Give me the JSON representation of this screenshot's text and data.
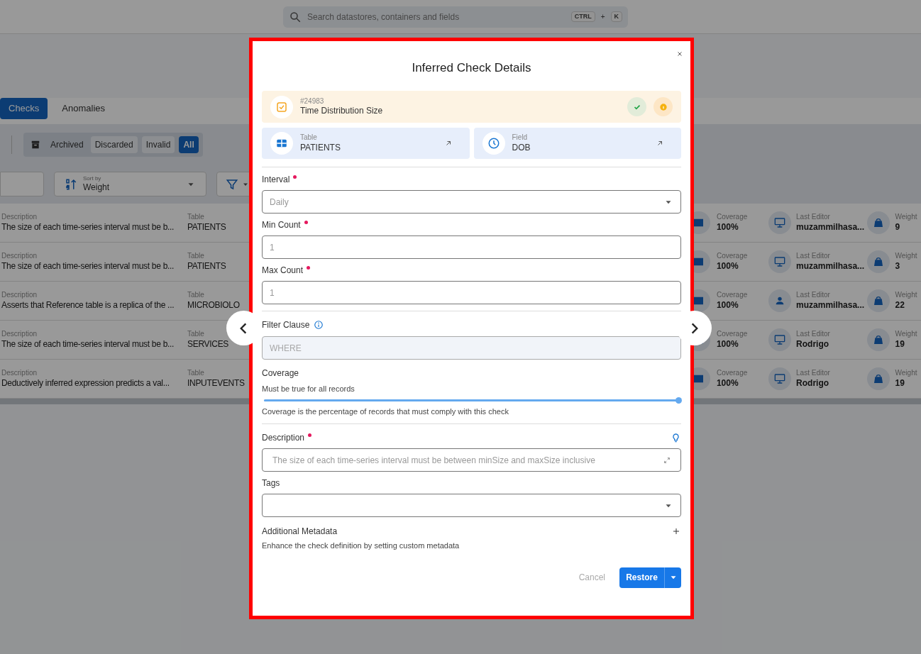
{
  "search": {
    "placeholder": "Search datastores, containers and fields",
    "keys": [
      "CTRL",
      "+",
      "K"
    ]
  },
  "tabs": [
    {
      "label": "Checks",
      "selected": true
    },
    {
      "label": "Anomalies",
      "selected": false
    }
  ],
  "status_filters": [
    {
      "label": "Archived",
      "kind": "header",
      "selected": false
    },
    {
      "label": "Discarded",
      "kind": "toggle",
      "selected": false
    },
    {
      "label": "Invalid",
      "kind": "toggle",
      "selected": false
    },
    {
      "label": "All",
      "kind": "toggle",
      "selected": true
    }
  ],
  "sort": {
    "label": "Sort by",
    "value": "Weight"
  },
  "checks": [
    {
      "description": {
        "label": "Description",
        "value": "The size of each time-series interval must be b..."
      },
      "table": {
        "label": "Table",
        "value": "PATIENTS"
      },
      "coverage": {
        "label": "Coverage",
        "value": "100%"
      },
      "last_editor": {
        "label": "Last Editor",
        "value": "muzammilhasa...",
        "kind": "monitor"
      },
      "weight": {
        "label": "Weight",
        "value": "9"
      }
    },
    {
      "description": {
        "label": "Description",
        "value": "The size of each time-series interval must be b..."
      },
      "table": {
        "label": "Table",
        "value": "PATIENTS"
      },
      "coverage": {
        "label": "Coverage",
        "value": "100%"
      },
      "last_editor": {
        "label": "Last Editor",
        "value": "muzammilhasa...",
        "kind": "monitor"
      },
      "weight": {
        "label": "Weight",
        "value": "3"
      }
    },
    {
      "description": {
        "label": "Description",
        "value": "Asserts that Reference table is a replica of the ..."
      },
      "table": {
        "label": "Table",
        "value": "MICROBIOLO"
      },
      "coverage": {
        "label": "Coverage",
        "value": "100%"
      },
      "last_editor": {
        "label": "Last Editor",
        "value": "muzammilhasa...",
        "kind": "person"
      },
      "weight": {
        "label": "Weight",
        "value": "22"
      }
    },
    {
      "description": {
        "label": "Description",
        "value": "The size of each time-series interval must be b..."
      },
      "table": {
        "label": "Table",
        "value": "SERVICES"
      },
      "coverage": {
        "label": "Coverage",
        "value": "100%"
      },
      "last_editor": {
        "label": "Last Editor",
        "value": "Rodrigo",
        "kind": "monitor"
      },
      "weight": {
        "label": "Weight",
        "value": "19"
      }
    },
    {
      "description": {
        "label": "Description",
        "value": "Deductively inferred expression predicts a val..."
      },
      "table": {
        "label": "Table",
        "value": "INPUTEVENTS"
      },
      "coverage": {
        "label": "Coverage",
        "value": "100%"
      },
      "last_editor": {
        "label": "Last Editor",
        "value": "Rodrigo",
        "kind": "monitor"
      },
      "weight": {
        "label": "Weight",
        "value": "19"
      }
    }
  ],
  "modal": {
    "title": "Inferred Check Details",
    "check": {
      "id": "#24983",
      "name": "Time Distribution Size"
    },
    "links": [
      {
        "kind": "table",
        "label": "Table",
        "value": "PATIENTS"
      },
      {
        "kind": "field",
        "label": "Field",
        "value": "DOB"
      }
    ],
    "sections": [
      [
        {
          "kind": "select",
          "label": "Interval",
          "required": true,
          "disabled": true,
          "value": "Daily"
        },
        {
          "kind": "text",
          "label": "Min Count",
          "required": true,
          "disabled": true,
          "value": "1"
        },
        {
          "kind": "text",
          "label": "Max Count",
          "required": true,
          "disabled": true,
          "value": "1"
        }
      ],
      [
        {
          "kind": "filter",
          "label": "Filter Clause",
          "required": false,
          "placeholder": "WHERE"
        },
        {
          "kind": "slider",
          "label": "Coverage",
          "required": false,
          "hint": "Must be true for all records",
          "level": 1,
          "note": "Coverage is the percentage of records that must comply with this check"
        }
      ],
      [
        {
          "kind": "textarea",
          "label": "Description",
          "required": true,
          "disabled": true,
          "value": "The size of each time-series interval must be between minSize and maxSize inclusive"
        },
        {
          "kind": "select",
          "label": "Tags",
          "required": false
        },
        {
          "kind": "metadata",
          "label": "Additional Metadata",
          "required": false,
          "note": "Enhance the check definition by setting custom metadata"
        }
      ]
    ],
    "buttons": {
      "cancel": "Cancel",
      "restore": "Restore"
    }
  }
}
